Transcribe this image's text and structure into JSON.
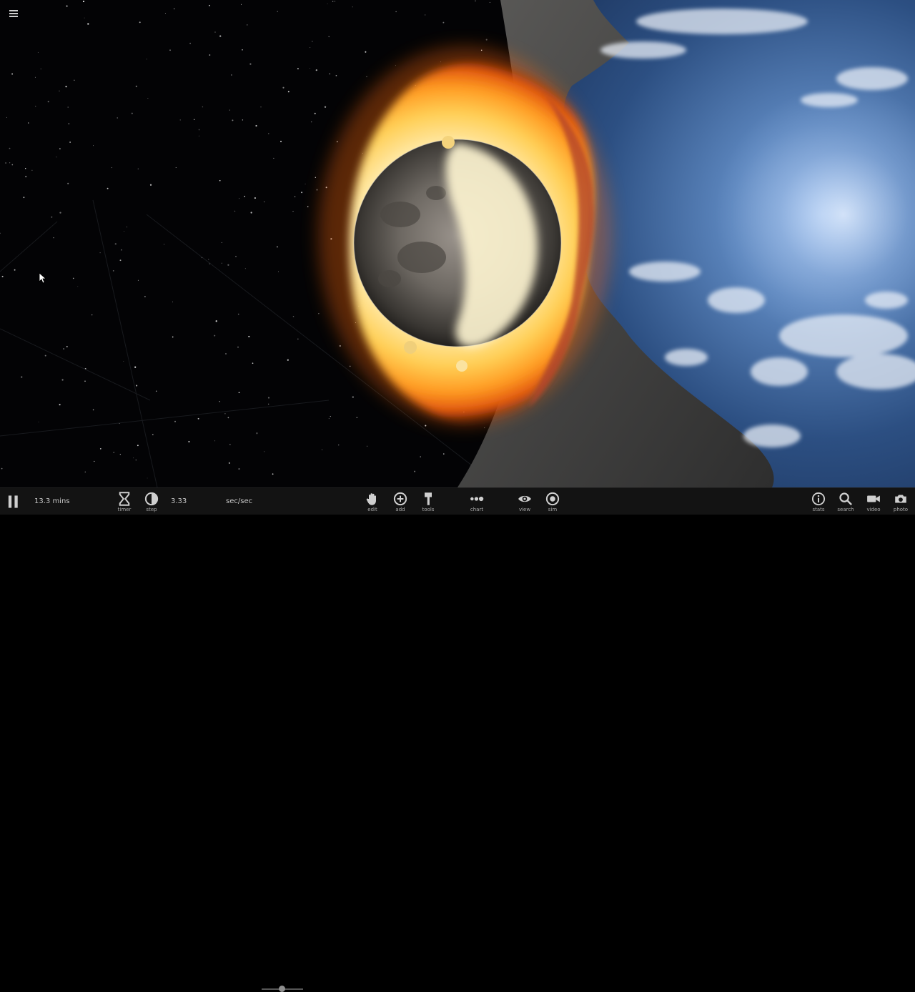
{
  "colors": {
    "space": "#030305",
    "toolbar_bg": "#131313",
    "toolbar_text": "#c8c8c8",
    "fire_core": "#fff6d6",
    "fire_outer": "#ff7a12",
    "ocean": "#2b4f82"
  },
  "icons": {
    "menu": "menu-icon",
    "pause": "pause-icon",
    "timer": "hourglass-icon",
    "step": "half-circle-icon",
    "edit": "hand-icon",
    "add": "plus-circle-icon",
    "tools": "hammer-icon",
    "chart": "dots-icon",
    "view": "eye-icon",
    "sim": "target-circle-icon",
    "stats": "info-circle-icon",
    "search": "magnifier-icon",
    "video": "video-camera-icon",
    "photo": "camera-icon"
  },
  "toolbar": {
    "elapsed_time": "13.3 mins",
    "timer_label": "timer",
    "step_label": "step",
    "step_value": "3.33",
    "rate_unit": "sec/sec",
    "edit_label": "edit",
    "add_label": "add",
    "tools_label": "tools",
    "chart_label": "chart",
    "view_label": "view",
    "sim_label": "sim",
    "stats_label": "stats",
    "search_label": "search",
    "video_label": "video",
    "photo_label": "photo"
  }
}
